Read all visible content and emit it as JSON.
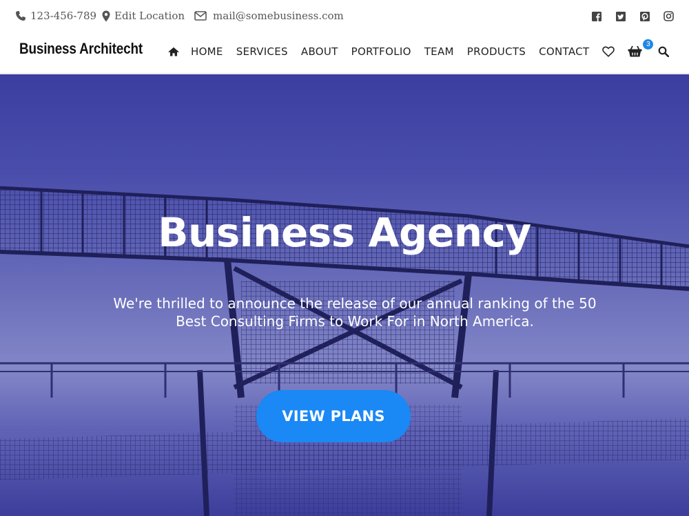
{
  "topbar": {
    "phone": "123-456-789",
    "location": "Edit Location",
    "email": "mail@somebusiness.com",
    "social": [
      "facebook-icon",
      "twitter-icon",
      "pinterest-icon",
      "instagram-icon"
    ]
  },
  "header": {
    "brand": "Business Architecht",
    "nav": [
      "HOME",
      "SERVICES",
      "ABOUT",
      "PORTFOLIO",
      "TEAM",
      "PRODUCTS",
      "CONTACT"
    ],
    "cart_count": "3"
  },
  "hero": {
    "title": "Business Agency",
    "subtitle": "We're thrilled to announce the release of our annual ranking of the 50 Best Consulting Firms to Work For in North America.",
    "cta": "VIEW PLANS"
  },
  "colors": {
    "accent": "#1a88f5",
    "hero_tint": "#4a4ca8",
    "text_dark": "#222222"
  }
}
